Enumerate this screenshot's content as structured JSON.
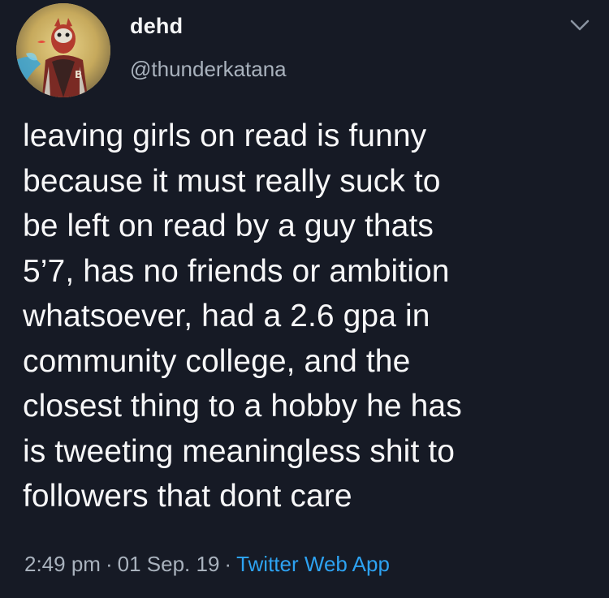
{
  "user": {
    "display_name": "dehd",
    "handle": "@thunderkatana",
    "avatar_icon": "avatar-illustration-icon",
    "avatar_jersey_letter": "B"
  },
  "tweet": {
    "text": "leaving girls on read is funny\nbecause it must really suck to\nbe left on read by a guy thats\n5’7,  has no friends or ambition\nwhatsoever, had a 2.6 gpa in\ncommunity college, and the\nclosest thing to a hobby he has\nis tweeting meaningless shit to\nfollowers that dont care"
  },
  "meta": {
    "time": "2:49 pm",
    "separator": "·",
    "date": "01 Sep. 19",
    "source": "Twitter Web App"
  },
  "menu": {
    "icon": "chevron-down-icon"
  },
  "colors": {
    "background": "#161a25",
    "text_primary": "#f7f7f8",
    "text_secondary": "#a9b2bd",
    "link": "#2da2f2"
  }
}
